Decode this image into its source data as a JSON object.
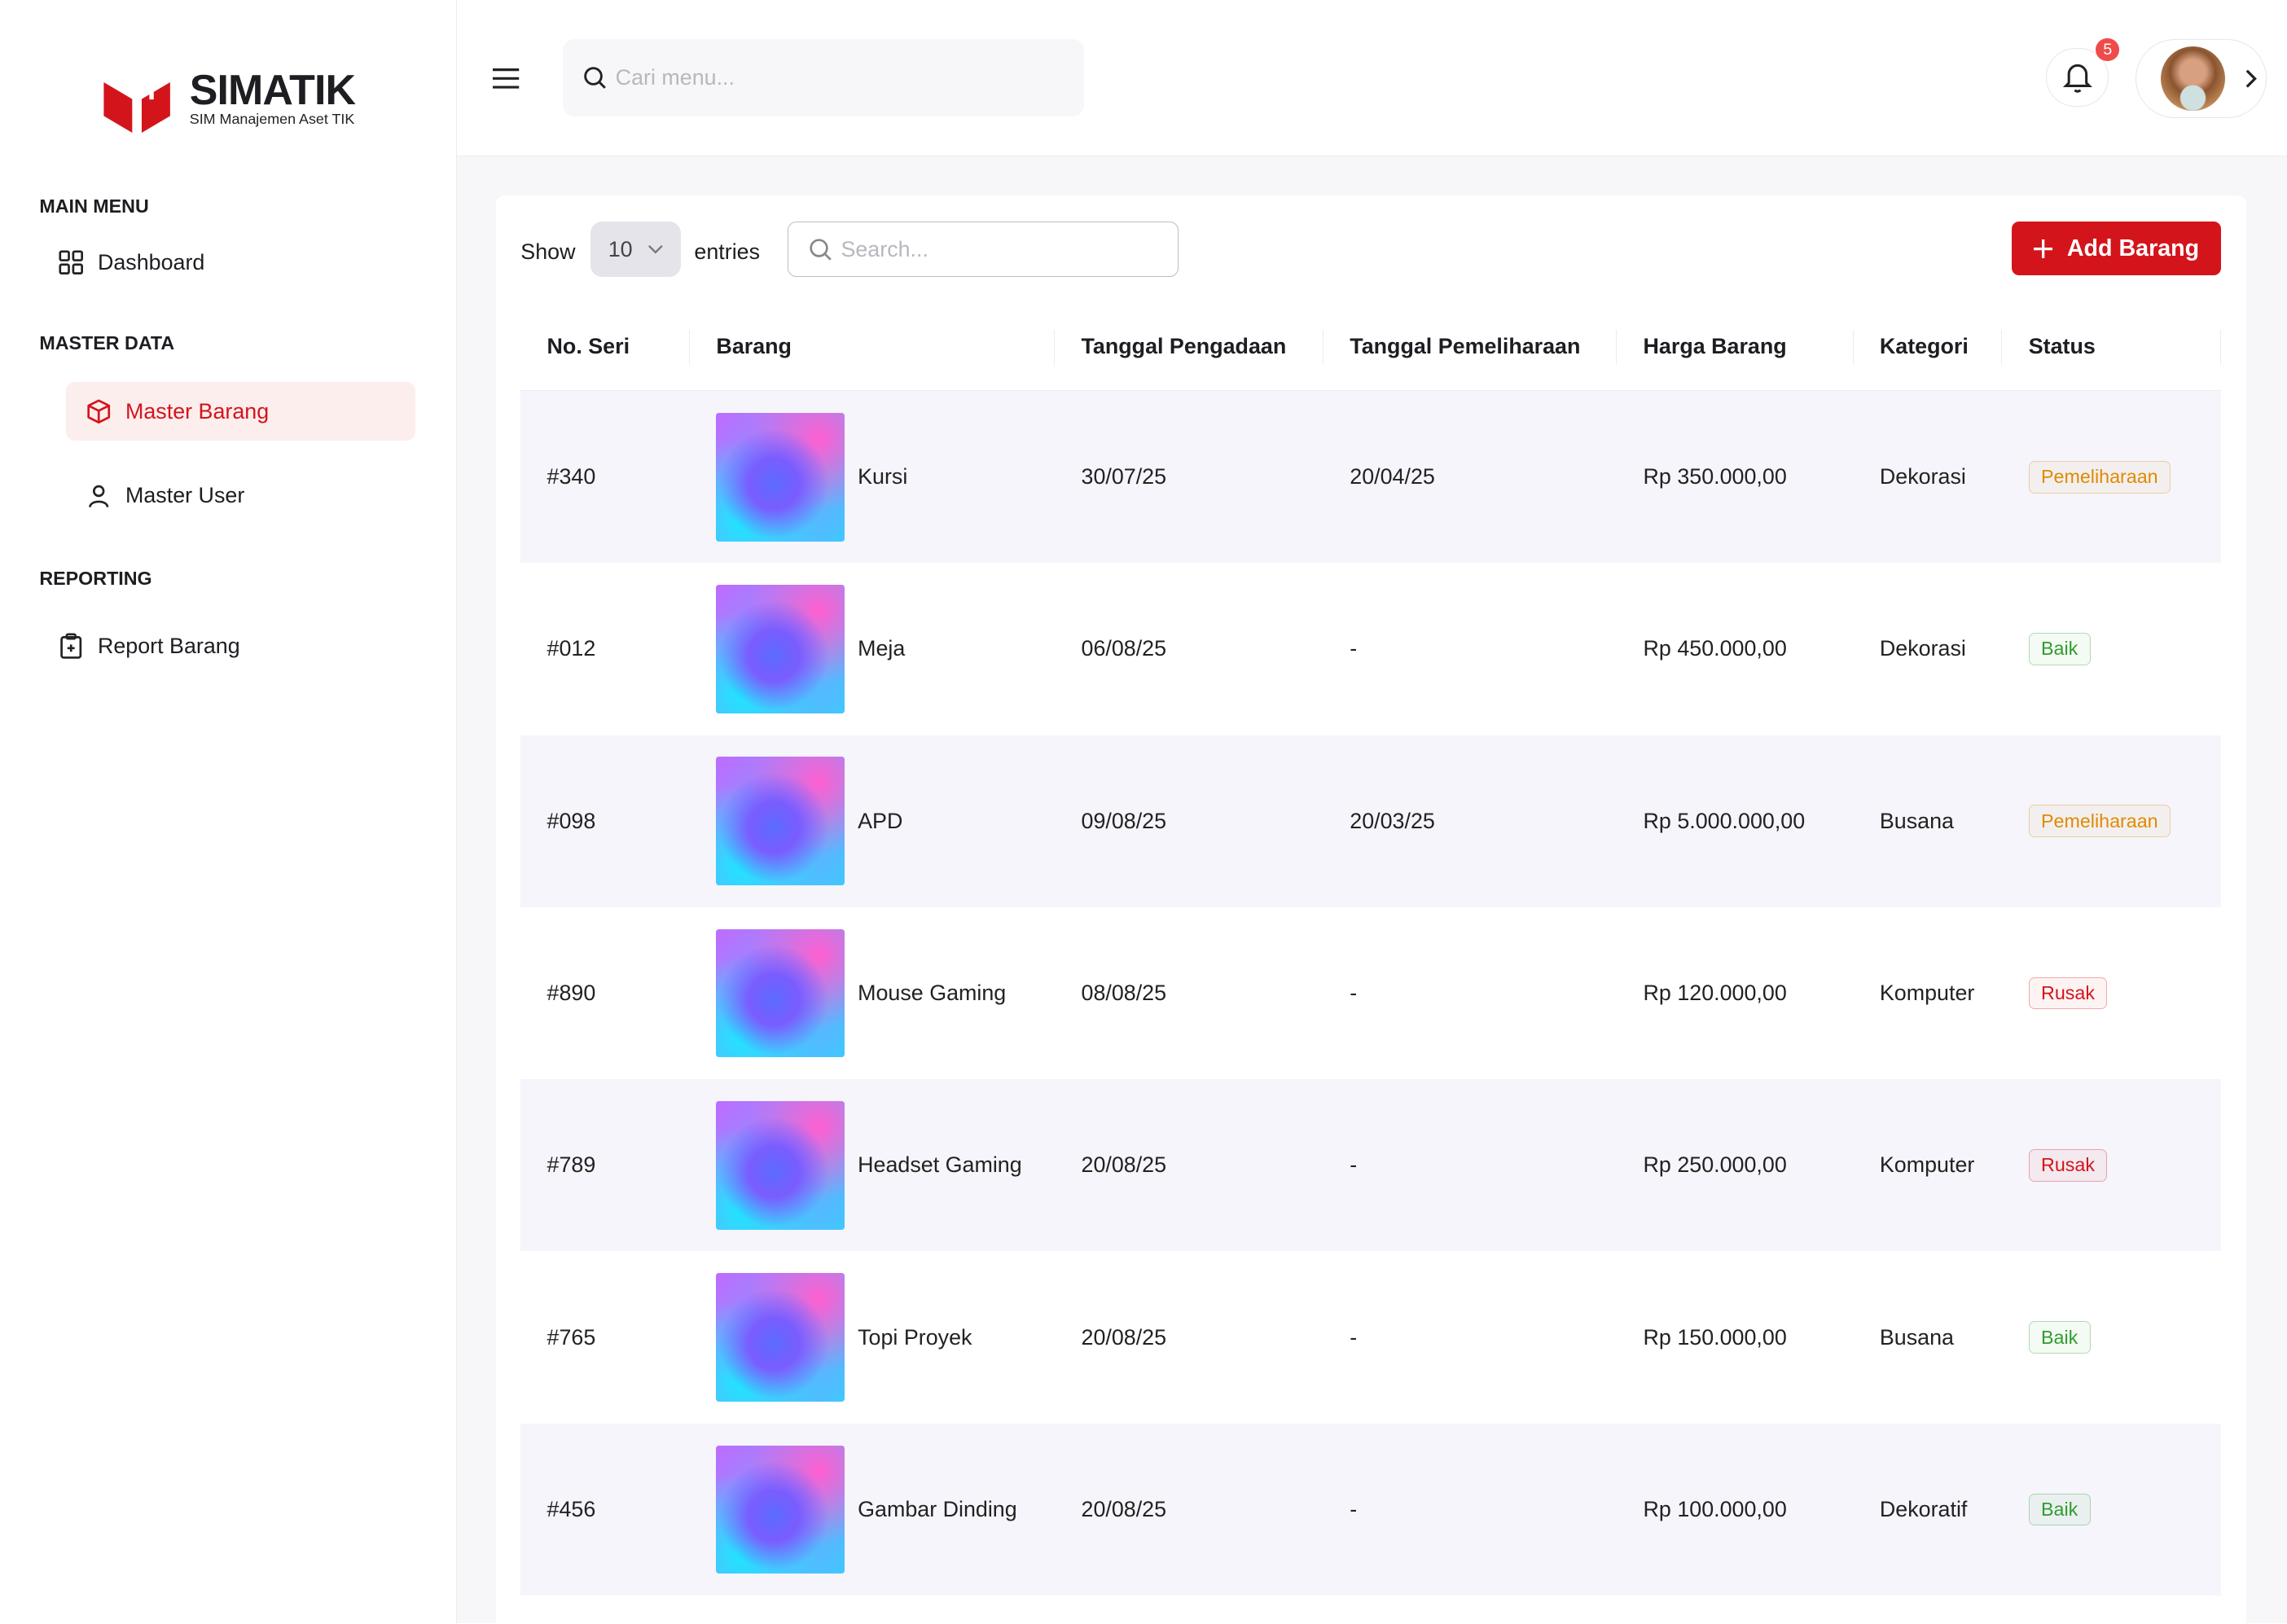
{
  "app": {
    "name": "SIMATIK",
    "subtitle": "SIM Manajemen Aset TIK",
    "brand_color": "#d4141b"
  },
  "sidebar": {
    "sections": [
      {
        "title": "MAIN MENU",
        "items": [
          {
            "label": "Dashboard",
            "icon": "grid-icon"
          }
        ]
      },
      {
        "title": "MASTER DATA",
        "items": [
          {
            "label": "Master Barang",
            "icon": "box-icon",
            "active": true
          },
          {
            "label": "Master User",
            "icon": "user-icon"
          }
        ]
      },
      {
        "title": "REPORTING",
        "items": [
          {
            "label": "Report Barang",
            "icon": "clipboard-icon"
          }
        ]
      }
    ]
  },
  "header": {
    "search_placeholder": "Cari menu...",
    "notification_count": "5"
  },
  "toolbar": {
    "show_label": "Show",
    "entries_value": "10",
    "entries_label": "entries",
    "search_placeholder": "Search...",
    "add_label": "Add Barang"
  },
  "table": {
    "columns": [
      "No. Seri",
      "Barang",
      "Tanggal Pengadaan",
      "Tanggal Pemeliharaan",
      "Harga Barang",
      "Kategori",
      "Status"
    ],
    "rows": [
      [
        "#340",
        "Kursi",
        "30/07/25",
        "20/04/25",
        "Rp 350.000,00",
        "Dekorasi",
        "Pemeliharaan"
      ],
      [
        "#012",
        "Meja",
        "06/08/25",
        "-",
        "Rp 450.000,00",
        "Dekorasi",
        "Baik"
      ],
      [
        "#098",
        "APD",
        "09/08/25",
        "20/03/25",
        "Rp 5.000.000,00",
        "Busana",
        "Pemeliharaan"
      ],
      [
        "#890",
        "Mouse Gaming",
        "08/08/25",
        "-",
        "Rp 120.000,00",
        "Komputer",
        "Rusak"
      ],
      [
        "#789",
        "Headset Gaming",
        "20/08/25",
        "-",
        "Rp 250.000,00",
        "Komputer",
        "Rusak"
      ],
      [
        "#765",
        "Topi Proyek",
        "20/08/25",
        "-",
        "Rp 150.000,00",
        "Busana",
        "Baik"
      ],
      [
        "#456",
        "Gambar Dinding",
        "20/08/25",
        "-",
        "Rp 100.000,00",
        "Dekoratif",
        "Baik"
      ]
    ]
  },
  "status_colors": {
    "Pemeliharaan": "#e08a00",
    "Baik": "#2e9d2e",
    "Rusak": "#d4141b"
  }
}
